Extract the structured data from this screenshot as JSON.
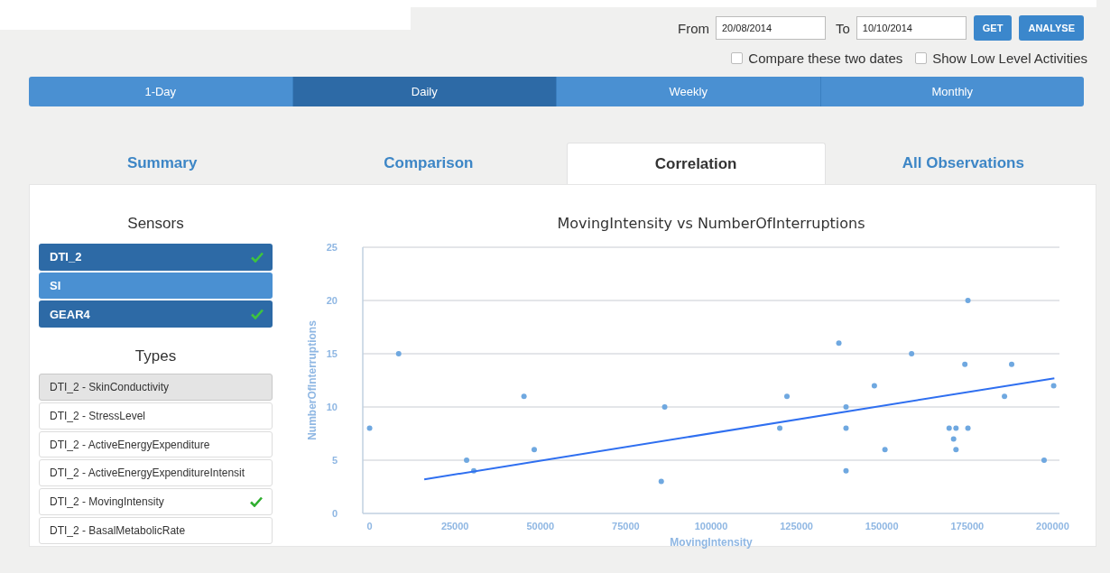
{
  "date_range": {
    "from_label": "From",
    "from_value": "20/08/2014",
    "to_label": "To",
    "to_value": "10/10/2014"
  },
  "buttons": [
    {
      "label": "GET"
    },
    {
      "label": "ANALYSE"
    }
  ],
  "options": [
    {
      "label": "Compare these two dates",
      "checked": false
    },
    {
      "label": "Show Low Level Activities",
      "checked": false
    }
  ],
  "periods": [
    {
      "label": "1-Day",
      "selected": false
    },
    {
      "label": "Daily",
      "selected": true
    },
    {
      "label": "Weekly",
      "selected": false
    },
    {
      "label": "Monthly",
      "selected": false
    }
  ],
  "tabs": [
    {
      "label": "Summary",
      "selected": false
    },
    {
      "label": "Comparison",
      "selected": false
    },
    {
      "label": "Correlation",
      "selected": true
    },
    {
      "label": "All Observations",
      "selected": false
    }
  ],
  "sensors": {
    "title": "Sensors",
    "items": [
      {
        "label": "DTI_2",
        "checked": true
      },
      {
        "label": "SI",
        "checked": false
      },
      {
        "label": "GEAR4",
        "checked": true
      }
    ]
  },
  "types": {
    "title": "Types",
    "items": [
      {
        "label": "DTI_2 - SkinConductivity",
        "checked": false,
        "selected": true
      },
      {
        "label": "DTI_2 - StressLevel",
        "checked": false,
        "selected": false
      },
      {
        "label": "DTI_2 - ActiveEnergyExpenditure",
        "checked": false,
        "selected": false
      },
      {
        "label": "DTI_2 - ActiveEnergyExpenditureIntensit",
        "checked": false,
        "selected": false
      },
      {
        "label": "DTI_2 - MovingIntensity",
        "checked": true,
        "selected": false
      },
      {
        "label": "DTI_2 - BasalMetabolicRate",
        "checked": false,
        "selected": false
      }
    ]
  },
  "chart": {
    "chart_data": {
      "type": "scatter",
      "title": "MovingIntensity vs NumberOfInterruptions",
      "xlabel": "MovingIntensity",
      "ylabel": "NumberOfInterruptions",
      "x": [
        0,
        8500,
        28400,
        30500,
        45200,
        48200,
        85400,
        86400,
        120100,
        122200,
        137400,
        139500,
        139500,
        139500,
        147800,
        150900,
        158700,
        169700,
        171000,
        171700,
        171700,
        174300,
        175200,
        175200,
        185900,
        188000,
        197500,
        200300,
        16000,
        200500
      ],
      "series": [
        {
          "color": "#6fa8e0",
          "values": [
            8,
            15,
            5,
            4,
            11,
            6,
            3,
            10,
            8,
            11,
            16,
            10,
            8,
            4,
            12,
            6,
            15,
            8,
            7,
            8,
            6,
            14,
            20,
            8,
            11,
            14,
            5,
            12,
            null,
            null
          ]
        },
        {
          "type": "line",
          "color": "#2f6ff0",
          "values": [
            null,
            null,
            null,
            null,
            null,
            null,
            null,
            null,
            null,
            null,
            null,
            null,
            null,
            null,
            null,
            null,
            null,
            null,
            null,
            null,
            null,
            null,
            null,
            null,
            null,
            null,
            null,
            null,
            3.2,
            12.7
          ]
        }
      ],
      "grid": true,
      "xlim": [
        -2000,
        202000
      ],
      "ylim": [
        0,
        25
      ],
      "xticks": [
        0,
        25000,
        50000,
        75000,
        100000,
        125000,
        150000,
        175000,
        200000
      ],
      "yticks": [
        0,
        5,
        10,
        15,
        20,
        25
      ]
    }
  }
}
